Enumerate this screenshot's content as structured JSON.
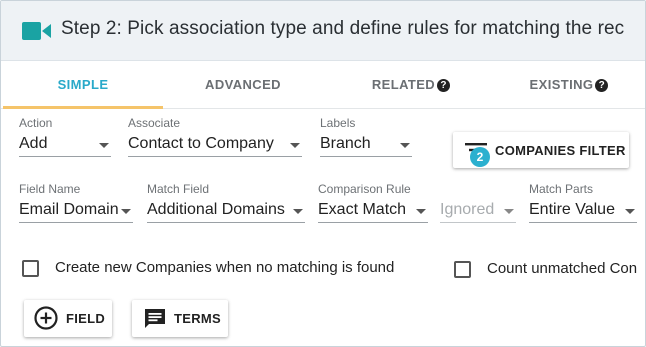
{
  "header": {
    "icon": "video-camera-icon",
    "title": "Step 2: Pick association type and define rules for matching the rec",
    "accent": "#1aa3a3"
  },
  "tabs": [
    {
      "label": "SIMPLE",
      "active": true
    },
    {
      "label": "ADVANCED",
      "active": false
    },
    {
      "label": "RELATED",
      "active": false,
      "help": "?"
    },
    {
      "label": "EXISTING",
      "active": false,
      "help": "?"
    }
  ],
  "row1": {
    "action": {
      "label": "Action",
      "value": "Add"
    },
    "associate": {
      "label": "Associate",
      "value": "Contact to Company"
    },
    "labels": {
      "label": "Labels",
      "value": "Branch"
    },
    "filter_button": {
      "label": "COMPANIES FILTER",
      "badge": "2",
      "icon": "filter-list-icon"
    }
  },
  "row2": {
    "field_name": {
      "label": "Field Name",
      "value": "Email Domain"
    },
    "match_field": {
      "label": "Match Field",
      "value": "Additional Domains"
    },
    "comparison_rule": {
      "label": "Comparison Rule",
      "value": "Exact Match"
    },
    "ignored": {
      "label": "",
      "value": "Ignored"
    },
    "match_parts": {
      "label": "Match Parts",
      "value": "Entire Value"
    }
  },
  "checkboxes": {
    "create_new": {
      "label": "Create new Companies when no matching is found",
      "checked": false
    },
    "count_unmatched": {
      "label": "Count unmatched Con",
      "checked": false
    }
  },
  "buttons": {
    "field": {
      "label": "FIELD",
      "icon": "add-circle-icon"
    },
    "terms": {
      "label": "TERMS",
      "icon": "chat-message-icon"
    }
  },
  "colors": {
    "active_tab": "#29a9c9",
    "tab_indicator": "#f5c46a",
    "badge": "#2bb0cf",
    "header_bg": "#eef2f5"
  }
}
